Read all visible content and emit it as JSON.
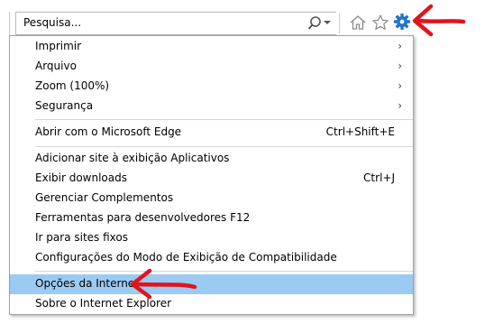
{
  "toolbar": {
    "search_placeholder": "Pesquisa...",
    "icons": [
      "search-icon",
      "dropdown-arrow-icon",
      "home-icon",
      "star-icon",
      "gear-icon"
    ]
  },
  "menu": {
    "items": [
      {
        "label": "Imprimir",
        "shortcut": "",
        "submenu": true
      },
      {
        "label": "Arquivo",
        "shortcut": "",
        "submenu": true
      },
      {
        "label": "Zoom (100%)",
        "shortcut": "",
        "submenu": true
      },
      {
        "label": "Segurança",
        "shortcut": "",
        "submenu": true
      },
      {
        "label": "Abrir com o Microsoft Edge",
        "shortcut": "Ctrl+Shift+E",
        "submenu": false
      },
      {
        "label": "Adicionar site à exibição Aplicativos",
        "shortcut": "",
        "submenu": false
      },
      {
        "label": "Exibir downloads",
        "shortcut": "Ctrl+J",
        "submenu": false
      },
      {
        "label": "Gerenciar Complementos",
        "shortcut": "",
        "submenu": false
      },
      {
        "label": "Ferramentas para desenvolvedores F12",
        "shortcut": "",
        "submenu": false
      },
      {
        "label": "Ir para sites fixos",
        "shortcut": "",
        "submenu": false
      },
      {
        "label": "Configurações do Modo de Exibição de Compatibilidade",
        "shortcut": "",
        "submenu": false
      },
      {
        "label": "Opções da Internet",
        "shortcut": "",
        "submenu": false,
        "highlighted": true
      },
      {
        "label": "Sobre o Internet Explorer",
        "shortcut": "",
        "submenu": false
      }
    ],
    "chevron": "›"
  },
  "colors": {
    "highlight": "#9bcaf3",
    "gear": "#1f73c9",
    "annotation_arrow": "#e2131b"
  }
}
